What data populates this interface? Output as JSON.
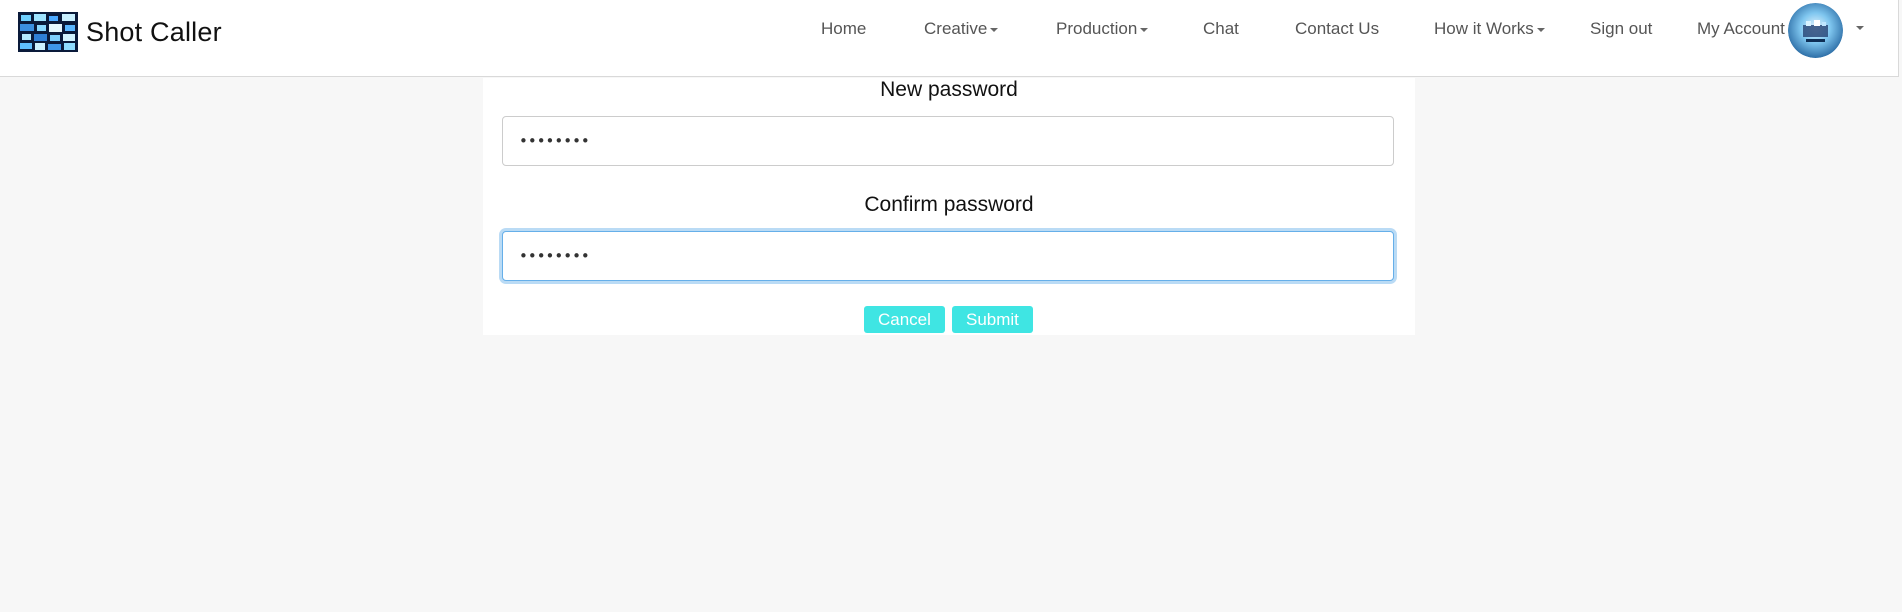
{
  "brand": {
    "name": "Shot Caller",
    "logo_icon": "film-grid-logo"
  },
  "nav": {
    "items": [
      {
        "label": "Home",
        "dropdown": false
      },
      {
        "label": "Creative",
        "dropdown": true
      },
      {
        "label": "Production",
        "dropdown": true
      },
      {
        "label": "Chat",
        "dropdown": false
      },
      {
        "label": "Contact Us",
        "dropdown": false
      },
      {
        "label": "How it Works",
        "dropdown": true
      },
      {
        "label": "Sign out",
        "dropdown": false
      }
    ],
    "account_label": "My Account",
    "account_icon": "user-avatar"
  },
  "form": {
    "new_password_label": "New password",
    "new_password_value": "••••••••",
    "confirm_password_label": "Confirm password",
    "confirm_password_value": "••••••••",
    "cancel_label": "Cancel",
    "submit_label": "Submit"
  },
  "colors": {
    "button_bg": "#3fe5e3",
    "focus_ring": "#66afe9",
    "page_bg": "#f7f7f7"
  }
}
